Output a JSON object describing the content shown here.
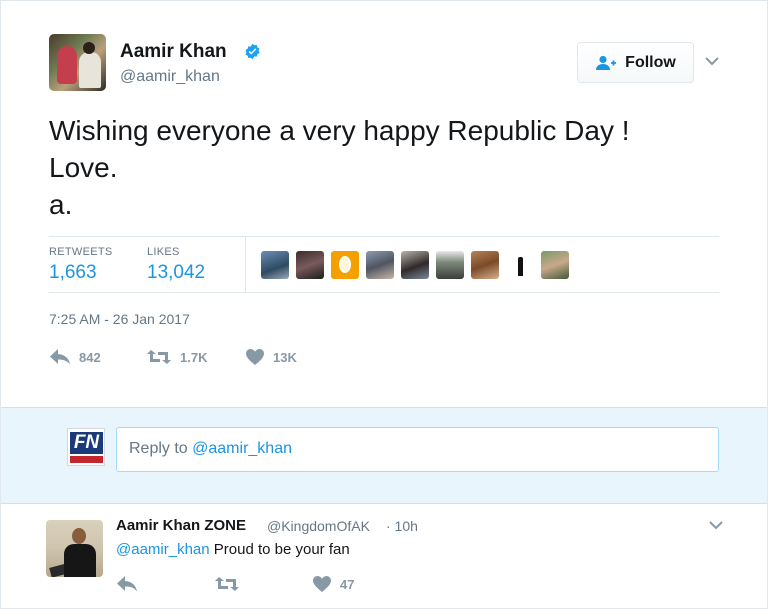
{
  "tweet": {
    "author": {
      "name": "Aamir Khan",
      "handle": "@aamir_khan",
      "verified": true
    },
    "follow_button": "Follow",
    "text": "Wishing everyone a very happy Republic Day !\nLove.\na.",
    "stats": {
      "retweets_label": "RETWEETS",
      "retweets_value": "1,663",
      "likes_label": "LIKES",
      "likes_value": "13,042"
    },
    "liker_avatars_count": 9,
    "timestamp": "7:25 AM - 26 Jan 2017",
    "actions": {
      "reply_count": "842",
      "retweet_count": "1.7K",
      "like_count": "13K"
    }
  },
  "reply_box": {
    "prefix": "Reply to ",
    "mention": "@aamir_khan"
  },
  "reply_tweet": {
    "author_name": "Aamir Khan ZONE",
    "author_handle": "@KingdomOfAK",
    "time": "· 10h",
    "mention": "@aamir_khan",
    "text": " Proud to be your fan",
    "actions": {
      "like_count": "47"
    }
  },
  "colors": {
    "link": "#1b95e0",
    "secondary": "#657786",
    "action": "#8899a6",
    "reply_band": "#e8f5fd"
  },
  "icons": [
    "verified-icon",
    "follow-person-icon",
    "chevron-down-icon",
    "reply-icon",
    "retweet-icon",
    "heart-icon"
  ]
}
